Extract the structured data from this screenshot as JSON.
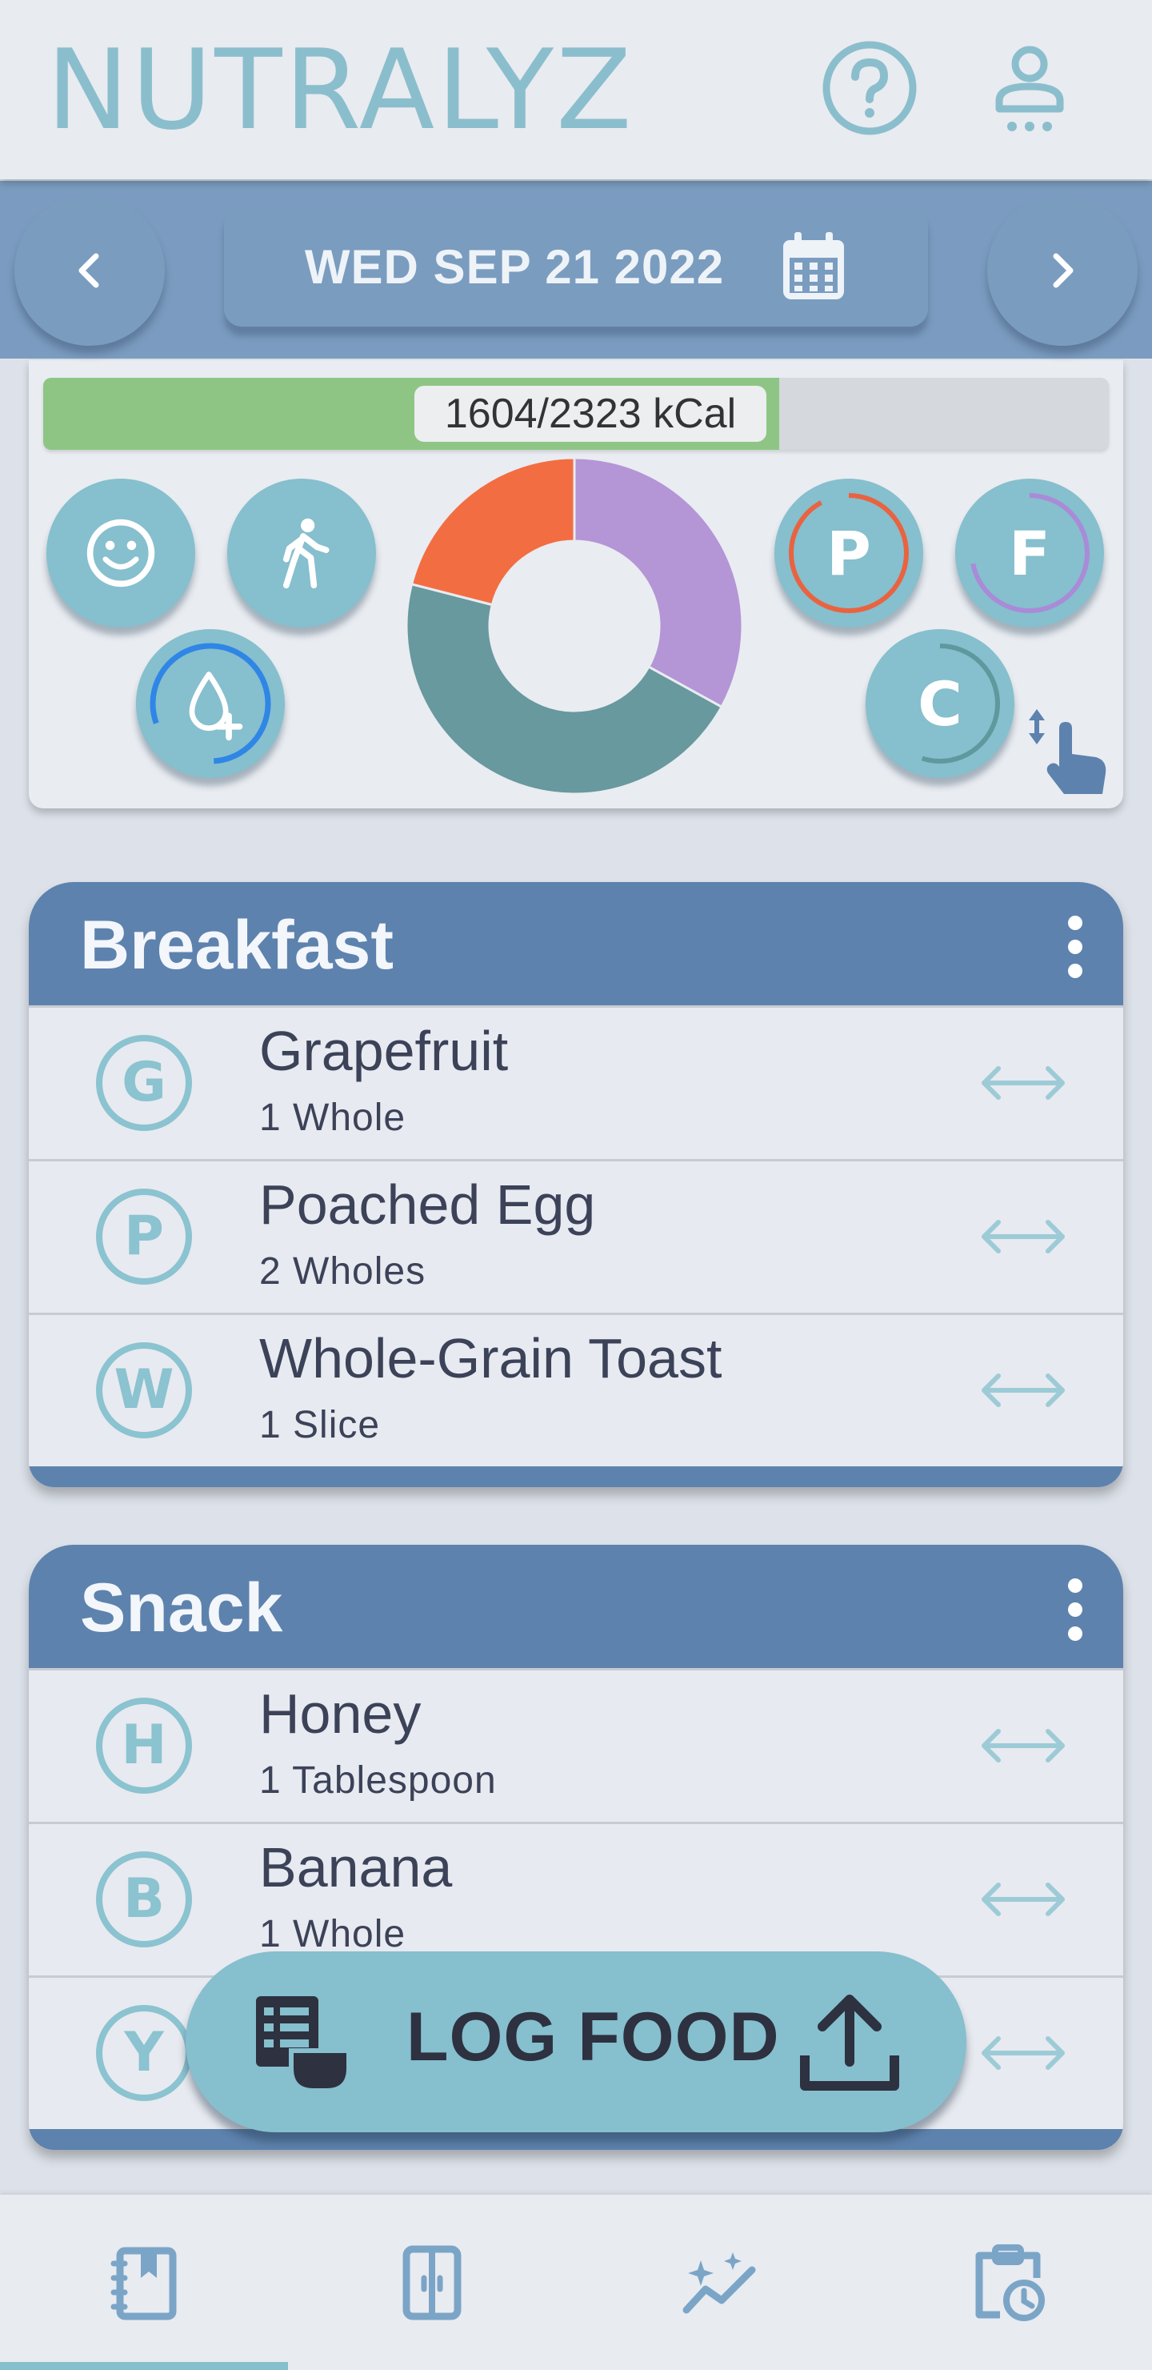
{
  "app": {
    "title": "NUTRALYZ"
  },
  "date_bar": {
    "date": "WED SEP 21 2022"
  },
  "summary": {
    "kcal_label": "1604/2323 kCal",
    "kcal_consumed": 1604,
    "kcal_goal": 2323,
    "macro_buttons": {
      "protein": "P",
      "fat": "F",
      "carbs": "C"
    },
    "macro_ring_progress": {
      "protein": 0.92,
      "fat": 0.72,
      "carbs": 0.55
    },
    "donut_segments": [
      {
        "name": "purple",
        "fraction": 0.33,
        "color": "#b495d6"
      },
      {
        "name": "teal",
        "fraction": 0.46,
        "color": "#67999e"
      },
      {
        "name": "orange",
        "fraction": 0.21,
        "color": "#f36d42"
      }
    ]
  },
  "meals": [
    {
      "title": "Breakfast",
      "items": [
        {
          "letter": "G",
          "name": "Grapefruit",
          "qty": "1 Whole"
        },
        {
          "letter": "P",
          "name": "Poached Egg",
          "qty": "2 Wholes"
        },
        {
          "letter": "W",
          "name": "Whole-Grain Toast",
          "qty": "1 Slice"
        }
      ]
    },
    {
      "title": "Snack",
      "items": [
        {
          "letter": "H",
          "name": "Honey",
          "qty": "1 Tablespoon"
        },
        {
          "letter": "B",
          "name": "Banana",
          "qty": "1 Whole"
        },
        {
          "letter": "Y",
          "name": "",
          "qty": ""
        }
      ]
    }
  ],
  "log_food": {
    "label": "LOG FOOD"
  },
  "bottom_nav": {
    "items": [
      "diary-icon",
      "pantry-icon",
      "trends-icon",
      "planner-icon"
    ],
    "active_index": 0
  },
  "colors": {
    "accent": "#86bfcd",
    "header_blue": "#5d82ad",
    "date_bar": "#7b9cc0",
    "kcal_fill": "#8ec585"
  }
}
